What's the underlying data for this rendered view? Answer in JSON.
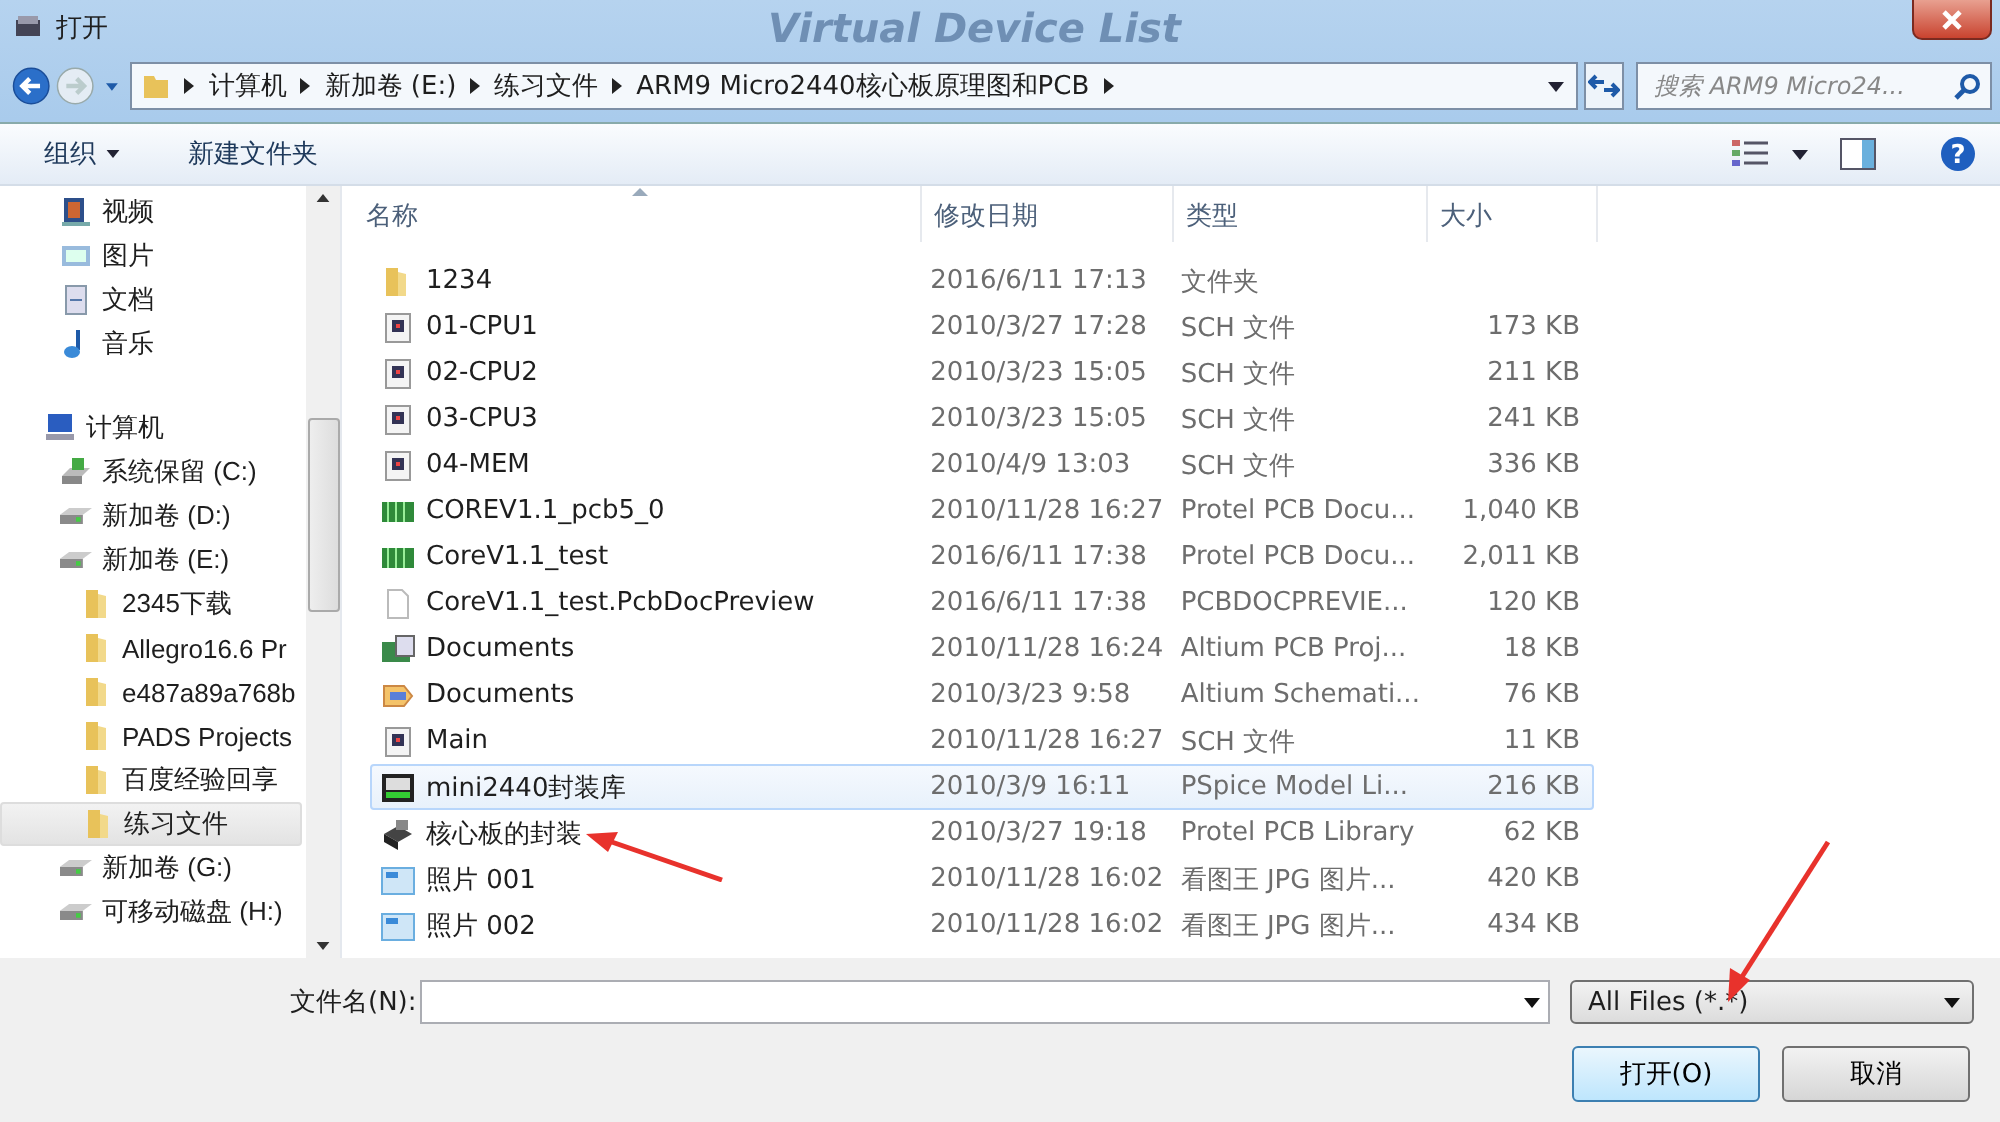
{
  "window": {
    "title": "打开",
    "background_text": "Virtual Device List"
  },
  "address": {
    "crumbs": [
      "计算机",
      "新加卷 (E:)",
      "练习文件",
      "ARM9 Micro2440核心板原理图和PCB"
    ],
    "search_placeholder": "搜索 ARM9 Micro24..."
  },
  "toolbar": {
    "organize": "组织",
    "new_folder": "新建文件夹",
    "help": "?"
  },
  "sidebar": {
    "items": [
      {
        "label": "视频",
        "kind": "video",
        "selected": false
      },
      {
        "label": "图片",
        "kind": "picture",
        "selected": false
      },
      {
        "label": "文档",
        "kind": "document",
        "selected": false
      },
      {
        "label": "音乐",
        "kind": "music",
        "selected": false
      },
      {
        "label": "计算机",
        "kind": "computer",
        "selected": false,
        "gap": true,
        "children": [
          {
            "label": "系统保留 (C:)",
            "kind": "system-drive",
            "selected": false
          },
          {
            "label": "新加卷 (D:)",
            "kind": "drive",
            "selected": false
          },
          {
            "label": "新加卷 (E:)",
            "kind": "drive",
            "selected": false,
            "children": [
              {
                "label": "2345下载",
                "kind": "folder",
                "selected": false
              },
              {
                "label": "Allegro16.6 Pr",
                "kind": "folder",
                "selected": false
              },
              {
                "label": "e487a89a768b",
                "kind": "folder",
                "selected": false
              },
              {
                "label": "PADS Projects",
                "kind": "folder",
                "selected": false
              },
              {
                "label": "百度经验回享",
                "kind": "folder",
                "selected": false
              },
              {
                "label": "练习文件",
                "kind": "folder",
                "selected": true
              }
            ]
          },
          {
            "label": "新加卷 (G:)",
            "kind": "drive",
            "selected": false
          },
          {
            "label": "可移动磁盘 (H:)",
            "kind": "removable",
            "selected": false
          }
        ]
      }
    ]
  },
  "table": {
    "columns": [
      "名称",
      "修改日期",
      "类型",
      "大小"
    ],
    "rows": [
      {
        "name": "1234",
        "date": "2016/6/11 17:13",
        "type": "文件夹",
        "kind": "folder",
        "selected": false
      },
      {
        "name": "01-CPU1",
        "date": "2010/3/27 17:28",
        "type": "SCH 文件",
        "size": "173 KB",
        "kind": "sch",
        "selected": false
      },
      {
        "name": "02-CPU2",
        "date": "2010/3/23 15:05",
        "type": "SCH 文件",
        "size": "211 KB",
        "kind": "sch",
        "selected": false
      },
      {
        "name": "03-CPU3",
        "date": "2010/3/23 15:05",
        "type": "SCH 文件",
        "size": "241 KB",
        "kind": "sch",
        "selected": false
      },
      {
        "name": "04-MEM",
        "date": "2010/4/9 13:03",
        "type": "SCH 文件",
        "size": "336 KB",
        "kind": "sch",
        "selected": false
      },
      {
        "name": "COREV1.1_pcb5_0",
        "date": "2010/11/28 16:27",
        "type": "Protel PCB Docu...",
        "size": "1,040 KB",
        "kind": "pcb",
        "selected": false
      },
      {
        "name": "CoreV1.1_test",
        "date": "2016/6/11 17:38",
        "type": "Protel PCB Docu...",
        "size": "2,011 KB",
        "kind": "pcb",
        "selected": false
      },
      {
        "name": "CoreV1.1_test.PcbDocPreview",
        "date": "2016/6/11 17:38",
        "type": "PCBDOCPREVIE...",
        "size": "120 KB",
        "kind": "blank",
        "selected": false
      },
      {
        "name": "Documents",
        "date": "2010/11/28 16:24",
        "type": "Altium PCB Proj...",
        "size": "18 KB",
        "kind": "project",
        "selected": false
      },
      {
        "name": "Documents",
        "date": "2010/3/23 9:58",
        "type": "Altium Schemati...",
        "size": "76 KB",
        "kind": "schproject",
        "selected": false
      },
      {
        "name": "Main",
        "date": "2010/11/28 16:27",
        "type": "SCH 文件",
        "size": "11 KB",
        "kind": "sch",
        "selected": false
      },
      {
        "name": "mini2440封装库",
        "date": "2010/3/9 16:11",
        "type": "PSpice Model Li...",
        "size": "216 KB",
        "kind": "chip",
        "selected": true
      },
      {
        "name": "核心板的封装",
        "date": "2010/3/27 19:18",
        "type": "Protel PCB Library",
        "size": "62 KB",
        "kind": "lib",
        "selected": false
      },
      {
        "name": "照片 001",
        "date": "2010/11/28 16:02",
        "type": "看图王 JPG 图片...",
        "size": "420 KB",
        "kind": "image",
        "selected": false
      },
      {
        "name": "照片 002",
        "date": "2010/11/28 16:02",
        "type": "看图王 JPG 图片...",
        "size": "434 KB",
        "kind": "image",
        "selected": false
      }
    ]
  },
  "footer": {
    "filename_label": "文件名(N):",
    "filetype": "All Files (*.*)",
    "open": "打开(O)",
    "cancel": "取消"
  }
}
